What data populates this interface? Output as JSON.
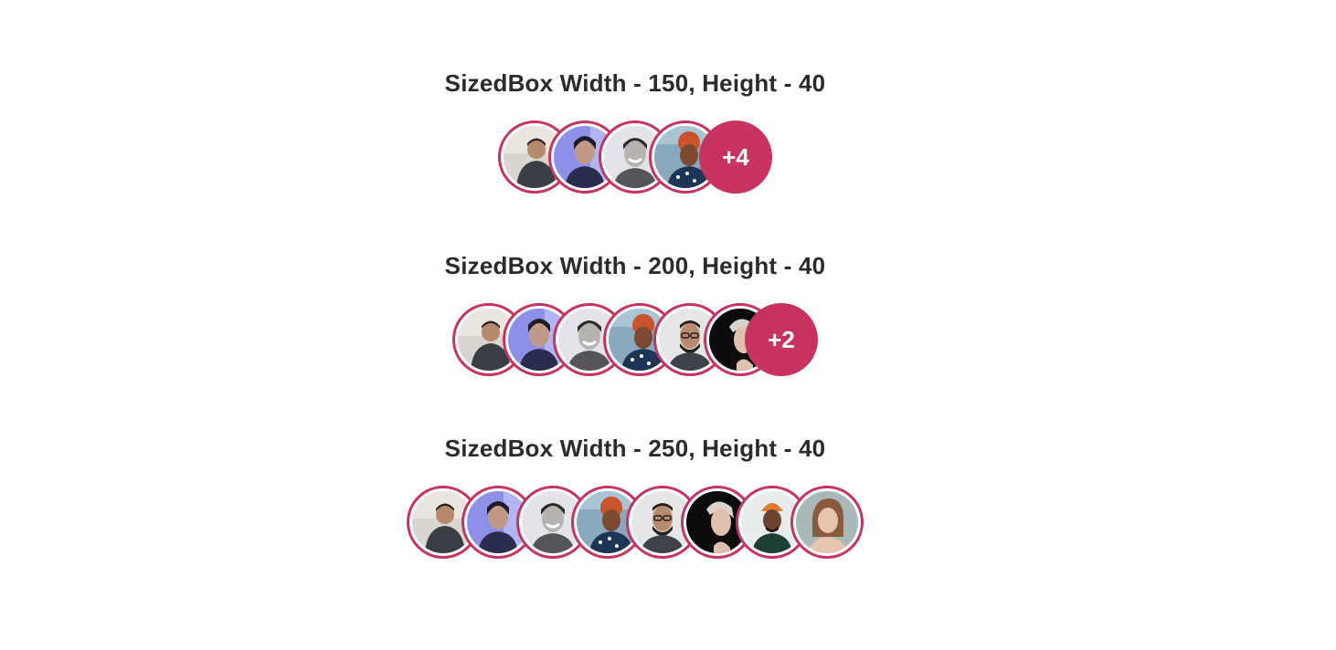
{
  "sections": [
    {
      "title": "SizedBox Width - 150, Height - 40",
      "avatars": [
        "person-1",
        "person-2",
        "person-3",
        "person-4"
      ],
      "more_label": "+4"
    },
    {
      "title": "SizedBox Width - 200, Height - 40",
      "avatars": [
        "person-1",
        "person-2",
        "person-3",
        "person-4",
        "person-5",
        "person-6"
      ],
      "more_label": "+2"
    },
    {
      "title": "SizedBox Width - 250, Height - 40",
      "avatars": [
        "person-1",
        "person-2",
        "person-3",
        "person-4",
        "person-5",
        "person-6",
        "person-7",
        "person-8"
      ],
      "more_label": ""
    }
  ],
  "colors": {
    "accent": "#c8325e",
    "title_text": "#2b2b2b",
    "background": "#ffffff"
  }
}
